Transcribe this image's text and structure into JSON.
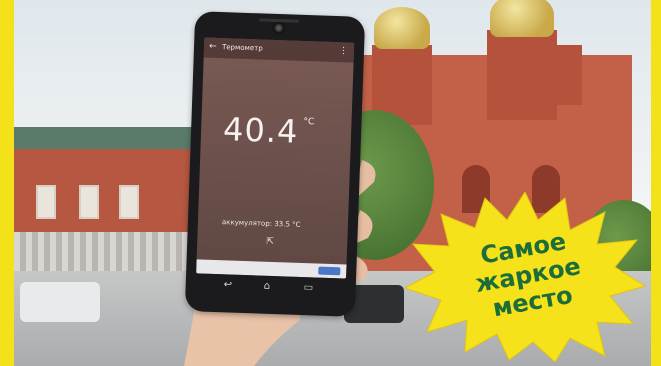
{
  "phone_app": {
    "title": "Термометр",
    "temperature": "40.4",
    "unit": "°C",
    "battery_text": "аккумулятор: 33.5 °C"
  },
  "badge": {
    "lines": [
      "Самое",
      "жаркое",
      "место"
    ],
    "fill_color": "#f6e21a",
    "text_color": "#1d6d3a"
  },
  "frame_color": "#f3e11a",
  "icons": {
    "back": "arrow-left-icon",
    "menu": "more-vert-icon",
    "share": "share-icon"
  }
}
